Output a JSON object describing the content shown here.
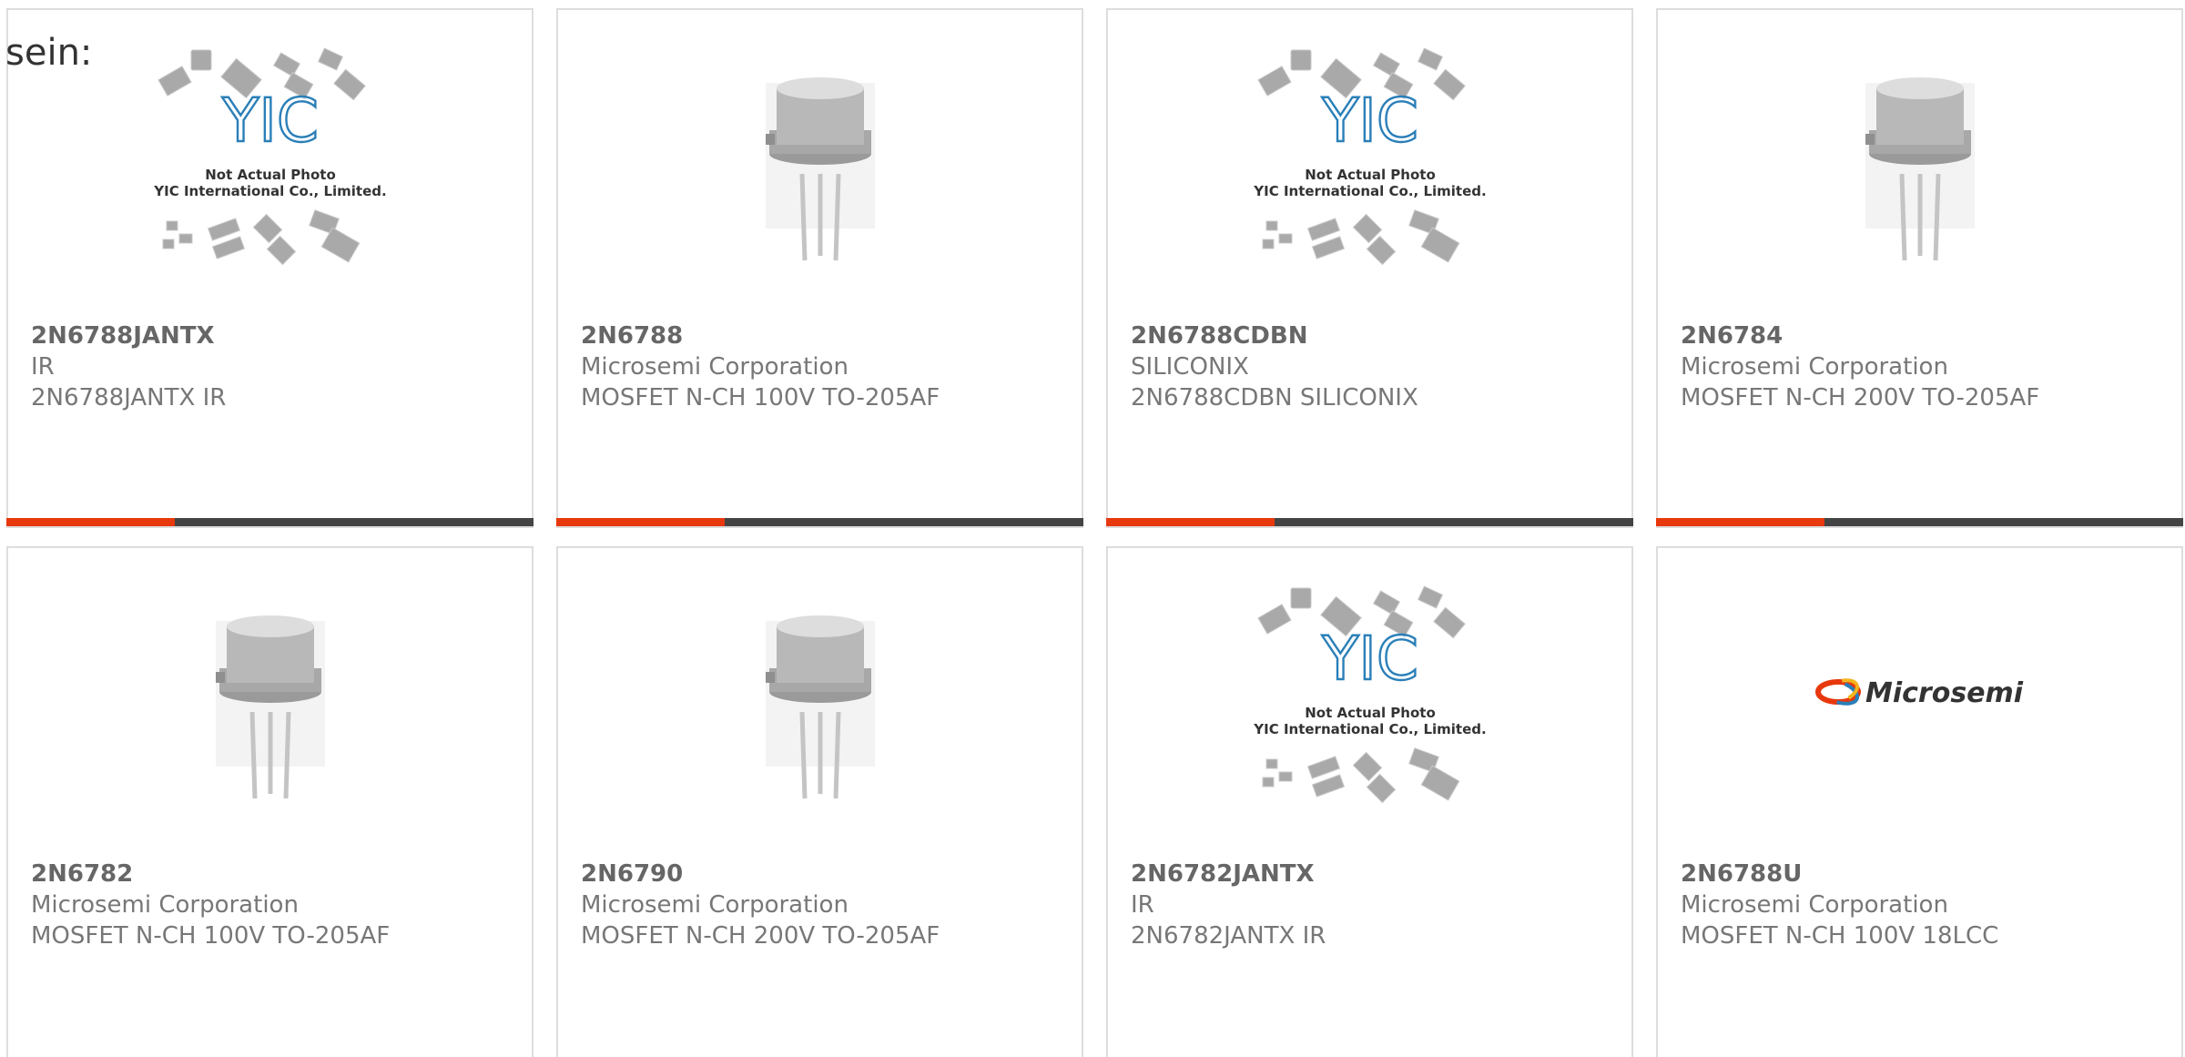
{
  "heading": "sein:",
  "colors": {
    "progress_accent": "#e8380d",
    "progress_track": "#444444",
    "card_border": "#dddddd",
    "yic_logo": "#2a7fb8"
  },
  "products": [
    {
      "part": "2N6788JANTX",
      "maker": "IR",
      "desc": "2N6788JANTX IR",
      "image": "yic-placeholder",
      "image_text_1": "Not Actual Photo",
      "image_text_2": "YIC International Co., Limited.",
      "progress": 0.32
    },
    {
      "part": "2N6788",
      "maker": "Microsemi Corporation",
      "desc": "MOSFET N-CH 100V TO-205AF",
      "image": "to-205af-can",
      "progress": 0.32
    },
    {
      "part": "2N6788CDBN",
      "maker": "SILICONIX",
      "desc": "2N6788CDBN SILICONIX",
      "image": "yic-placeholder",
      "image_text_1": "Not Actual Photo",
      "image_text_2": "YIC International Co., Limited.",
      "progress": 0.32
    },
    {
      "part": "2N6784",
      "maker": "Microsemi Corporation",
      "desc": "MOSFET N-CH 200V TO-205AF",
      "image": "to-205af-can",
      "progress": 0.32
    },
    {
      "part": "2N6782",
      "maker": "Microsemi Corporation",
      "desc": "MOSFET N-CH 100V TO-205AF",
      "image": "to-205af-can"
    },
    {
      "part": "2N6790",
      "maker": "Microsemi Corporation",
      "desc": "MOSFET N-CH 200V TO-205AF",
      "image": "to-205af-can"
    },
    {
      "part": "2N6782JANTX",
      "maker": "IR",
      "desc": "2N6782JANTX IR",
      "image": "yic-placeholder",
      "image_text_1": "Not Actual Photo",
      "image_text_2": "YIC International Co., Limited."
    },
    {
      "part": "2N6788U",
      "maker": "Microsemi Corporation",
      "desc": "MOSFET N-CH 100V 18LCC",
      "image": "microsemi-logo",
      "logo_text": "Microsemi"
    }
  ]
}
